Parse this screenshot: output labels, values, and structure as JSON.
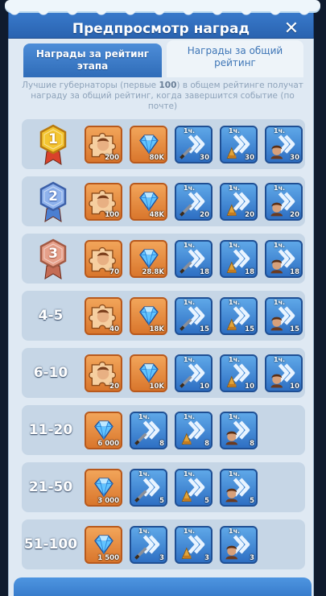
{
  "header": {
    "title": "Предпросмотр наград",
    "close_icon": "close-icon"
  },
  "tabs": [
    {
      "label": "Награды за рейтинг этапа",
      "active": false
    },
    {
      "label": "Награды за общий рейтинг",
      "active": true
    }
  ],
  "description": {
    "before": "Лучшие губернаторы (первые ",
    "highlight": "100",
    "after": ") в общем рейтинге получат награду за общий рейтинг, когда завершится событие (по почте)"
  },
  "colors": {
    "title_bar": "#2f6cb8",
    "panel": "#dfe9f3",
    "row": "#c6d6e6",
    "orange_frame": "#d9762c",
    "blue_frame": "#2e6fc3"
  },
  "rows": [
    {
      "rank": "1",
      "medal": "gold-medal-icon",
      "items": [
        {
          "icon": "hero-puzzle-icon",
          "frame": "orange",
          "qty": "200"
        },
        {
          "icon": "diamond-icon",
          "frame": "orange",
          "qty": "80K"
        },
        {
          "icon": "speedup-sword-icon",
          "frame": "blue",
          "tag": "1ч.",
          "qty": "30"
        },
        {
          "icon": "speedup-building-icon",
          "frame": "blue",
          "tag": "1ч.",
          "qty": "30"
        },
        {
          "icon": "speedup-hero-icon",
          "frame": "blue",
          "tag": "1ч.",
          "qty": "30"
        }
      ]
    },
    {
      "rank": "2",
      "medal": "silver-medal-icon",
      "items": [
        {
          "icon": "hero-puzzle-icon",
          "frame": "orange",
          "qty": "100"
        },
        {
          "icon": "diamond-icon",
          "frame": "orange",
          "qty": "48K"
        },
        {
          "icon": "speedup-sword-icon",
          "frame": "blue",
          "tag": "1ч.",
          "qty": "20"
        },
        {
          "icon": "speedup-building-icon",
          "frame": "blue",
          "tag": "1ч.",
          "qty": "20"
        },
        {
          "icon": "speedup-hero-icon",
          "frame": "blue",
          "tag": "1ч.",
          "qty": "20"
        }
      ]
    },
    {
      "rank": "3",
      "medal": "bronze-medal-icon",
      "items": [
        {
          "icon": "hero-puzzle-icon",
          "frame": "orange",
          "qty": "70"
        },
        {
          "icon": "diamond-icon",
          "frame": "orange",
          "qty": "28.8K"
        },
        {
          "icon": "speedup-sword-icon",
          "frame": "blue",
          "tag": "1ч.",
          "qty": "18"
        },
        {
          "icon": "speedup-building-icon",
          "frame": "blue",
          "tag": "1ч.",
          "qty": "18"
        },
        {
          "icon": "speedup-hero-icon",
          "frame": "blue",
          "tag": "1ч.",
          "qty": "18"
        }
      ]
    },
    {
      "rank": "4-5",
      "items": [
        {
          "icon": "hero-puzzle-icon",
          "frame": "orange",
          "qty": "40"
        },
        {
          "icon": "diamond-icon",
          "frame": "orange",
          "qty": "18K"
        },
        {
          "icon": "speedup-sword-icon",
          "frame": "blue",
          "tag": "1ч.",
          "qty": "15"
        },
        {
          "icon": "speedup-building-icon",
          "frame": "blue",
          "tag": "1ч.",
          "qty": "15"
        },
        {
          "icon": "speedup-hero-icon",
          "frame": "blue",
          "tag": "1ч.",
          "qty": "15"
        }
      ]
    },
    {
      "rank": "6-10",
      "items": [
        {
          "icon": "hero-puzzle-icon",
          "frame": "orange",
          "qty": "20"
        },
        {
          "icon": "diamond-icon",
          "frame": "orange",
          "qty": "10K"
        },
        {
          "icon": "speedup-sword-icon",
          "frame": "blue",
          "tag": "1ч.",
          "qty": "10"
        },
        {
          "icon": "speedup-building-icon",
          "frame": "blue",
          "tag": "1ч.",
          "qty": "10"
        },
        {
          "icon": "speedup-hero-icon",
          "frame": "blue",
          "tag": "1ч.",
          "qty": "10"
        }
      ]
    },
    {
      "rank": "11-20",
      "items": [
        {
          "icon": "diamond-icon",
          "frame": "orange",
          "qty": "6 000"
        },
        {
          "icon": "speedup-sword-icon",
          "frame": "blue",
          "tag": "1ч.",
          "qty": "8"
        },
        {
          "icon": "speedup-building-icon",
          "frame": "blue",
          "tag": "1ч.",
          "qty": "8"
        },
        {
          "icon": "speedup-hero-icon",
          "frame": "blue",
          "tag": "1ч.",
          "qty": "8"
        }
      ]
    },
    {
      "rank": "21-50",
      "items": [
        {
          "icon": "diamond-icon",
          "frame": "orange",
          "qty": "3 000"
        },
        {
          "icon": "speedup-sword-icon",
          "frame": "blue",
          "tag": "1ч.",
          "qty": "5"
        },
        {
          "icon": "speedup-building-icon",
          "frame": "blue",
          "tag": "1ч.",
          "qty": "5"
        },
        {
          "icon": "speedup-hero-icon",
          "frame": "blue",
          "tag": "1ч.",
          "qty": "5"
        }
      ]
    },
    {
      "rank": "51-100",
      "items": [
        {
          "icon": "diamond-icon",
          "frame": "orange",
          "qty": "1 500"
        },
        {
          "icon": "speedup-sword-icon",
          "frame": "blue",
          "tag": "1ч.",
          "qty": "3"
        },
        {
          "icon": "speedup-building-icon",
          "frame": "blue",
          "tag": "1ч.",
          "qty": "3"
        },
        {
          "icon": "speedup-hero-icon",
          "frame": "blue",
          "tag": "1ч.",
          "qty": "3"
        }
      ]
    }
  ]
}
